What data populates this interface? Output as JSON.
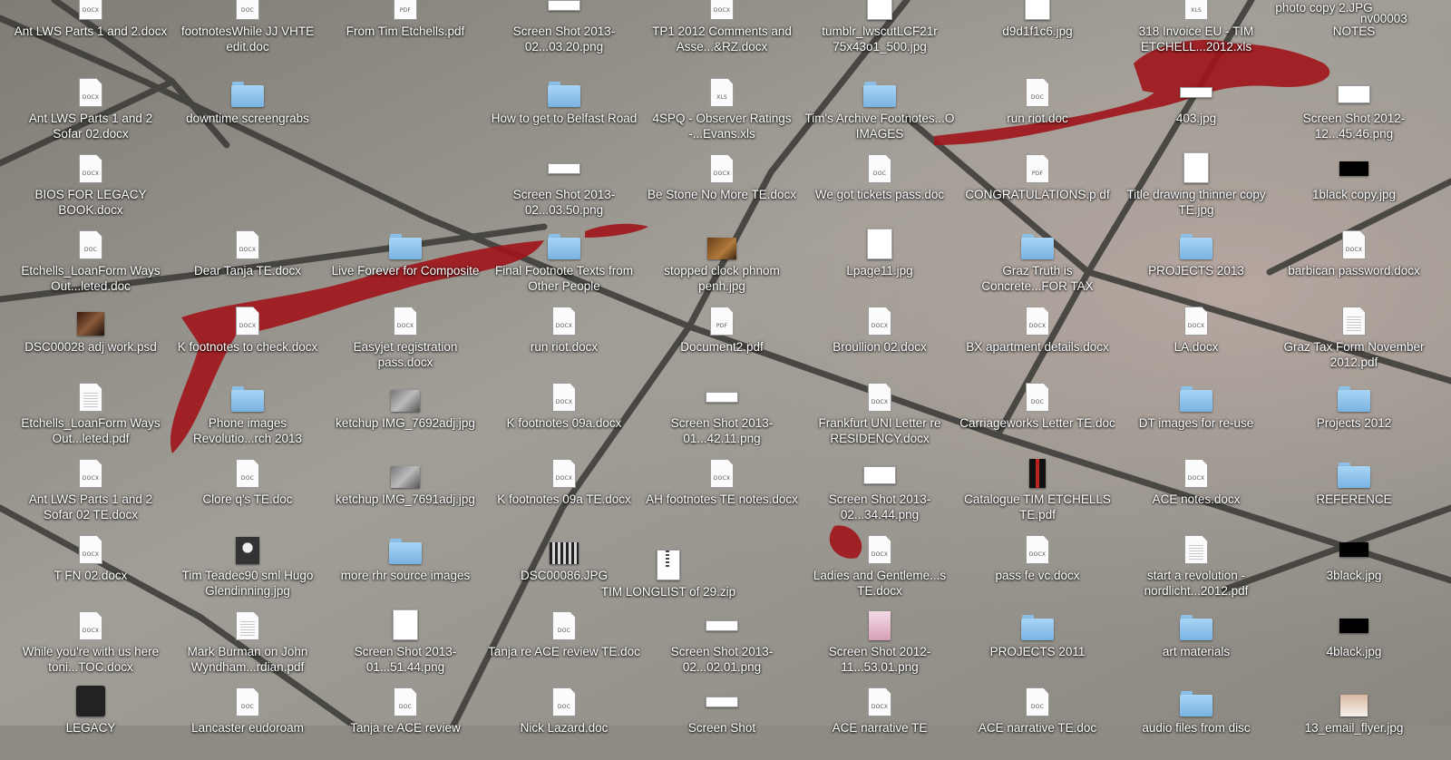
{
  "desktop": {
    "wallpaper": "street paving stones with red ketchup splatter",
    "icons": [
      [
        {
          "label": "Ant LWS Parts 1 and 2.docx",
          "icon": "doc-icon",
          "tag": "DOCX"
        },
        {
          "label": "Ant LWS Parts 1 and 2 Sofar 02.docx",
          "icon": "doc-icon",
          "tag": "DOCX"
        },
        {
          "label": "BIOS FOR LEGACY BOOK.docx",
          "icon": "doc-icon",
          "tag": "DOCX"
        },
        {
          "label": "Etchells_LoanForm Ways Out...leted.doc",
          "icon": "doc-icon",
          "tag": "DOC"
        },
        {
          "label": "DSC00028 adj work.psd",
          "icon": "image-thumb-icon",
          "thumb": "photo"
        },
        {
          "label": "Etchells_LoanForm Ways Out...leted.pdf",
          "icon": "doc-icon",
          "tag": "",
          "lines": true
        },
        {
          "label": "Ant LWS Parts 1 and 2 Sofar 02 TE.docx",
          "icon": "doc-icon",
          "tag": "DOCX"
        },
        {
          "label": "T FN 02.docx",
          "icon": "doc-icon",
          "tag": "DOCX"
        },
        {
          "label": "While you're with us here toni...TOC.docx",
          "icon": "doc-icon",
          "tag": "DOCX"
        },
        {
          "label": "LEGACY",
          "icon": "image-thumb-icon",
          "thumb": "legacy"
        }
      ],
      [
        {
          "label": "footnotesWhile JJ VHTE edit.doc",
          "icon": "doc-icon",
          "tag": "DOC"
        },
        {
          "label": "downtime screengrabs",
          "icon": "folder-icon"
        },
        {
          "label": "",
          "icon": "none"
        },
        {
          "label": "Dear Tanja TE.docx",
          "icon": "doc-icon",
          "tag": "DOCX"
        },
        {
          "label": "K footnotes to check.docx",
          "icon": "doc-icon",
          "tag": "DOCX"
        },
        {
          "label": "Phone images Revolutio...rch 2013",
          "icon": "folder-icon"
        },
        {
          "label": "Clore q's TE.doc",
          "icon": "doc-icon",
          "tag": "DOC"
        },
        {
          "label": "Tim Teadec90 sml Hugo Glendinning.jpg",
          "icon": "image-thumb-icon",
          "thumb": "face"
        },
        {
          "label": "Mark Burman on John Wyndham...rdian.pdf",
          "icon": "doc-icon",
          "tag": "",
          "lines": true
        },
        {
          "label": "Lancaster eudoroam",
          "icon": "doc-icon",
          "tag": "DOC"
        }
      ],
      [
        {
          "label": "From Tim Etchells.pdf",
          "icon": "doc-icon",
          "tag": "PDF"
        },
        {
          "label": "",
          "icon": "none"
        },
        {
          "label": "",
          "icon": "none"
        },
        {
          "label": "Live Forever for Composite",
          "icon": "folder-icon"
        },
        {
          "label": "Easyjet registration pass.docx",
          "icon": "doc-icon",
          "tag": "DOCX"
        },
        {
          "label": "ketchup IMG_7692adj.jpg",
          "icon": "image-thumb-icon",
          "thumb": "grey"
        },
        {
          "label": "ketchup IMG_7691adj.jpg",
          "icon": "image-thumb-icon",
          "thumb": "grey"
        },
        {
          "label": "more rhr source images",
          "icon": "folder-icon"
        },
        {
          "label": "Screen Shot 2013-01...51.44.png",
          "icon": "image-thumb-icon",
          "thumb": "white"
        },
        {
          "label": "Tanja re ACE review",
          "icon": "doc-icon",
          "tag": "DOC"
        }
      ],
      [
        {
          "label": "Screen Shot 2013-02...03.20.png",
          "icon": "screenshot-icon"
        },
        {
          "label": "How to get to Belfast Road",
          "icon": "folder-icon"
        },
        {
          "label": "Screen Shot 2013-02...03.50.png",
          "icon": "screenshot-icon"
        },
        {
          "label": "Final Footnote Texts from Other People",
          "icon": "folder-icon"
        },
        {
          "label": "run riot.docx",
          "icon": "doc-icon",
          "tag": "DOCX"
        },
        {
          "label": "K footnotes 09a.docx",
          "icon": "doc-icon",
          "tag": "DOCX"
        },
        {
          "label": "K footnotes 09a TE.docx",
          "icon": "doc-icon",
          "tag": "DOCX"
        },
        {
          "label": "DSC00086.JPG",
          "icon": "image-thumb-icon",
          "thumb": "film"
        },
        {
          "label": "Tanja re ACE review TE.doc",
          "icon": "doc-icon",
          "tag": "DOC"
        },
        {
          "label": "Nick Lazard.doc",
          "icon": "doc-icon",
          "tag": "DOC"
        }
      ],
      [
        {
          "label": "TP1 2012 Comments and Asse...&RZ.docx",
          "icon": "doc-icon",
          "tag": "DOCX"
        },
        {
          "label": "4SPQ - Observer Ratings -...Evans.xls",
          "icon": "doc-icon",
          "tag": "XLS"
        },
        {
          "label": "Be Stone No More TE.docx",
          "icon": "doc-icon",
          "tag": "DOCX"
        },
        {
          "label": "stopped clock phnom penh.jpg",
          "icon": "image-thumb-icon",
          "thumb": "brown"
        },
        {
          "label": "Document2.pdf",
          "icon": "doc-icon",
          "tag": "PDF"
        },
        {
          "label": "Screen Shot 2013-01...42.11.png",
          "icon": "screenshot-icon"
        },
        {
          "label": "AH footnotes TE notes.docx",
          "icon": "doc-icon",
          "tag": "DOCX"
        },
        {
          "label": "",
          "icon": "none"
        },
        {
          "label": "Screen Shot 2013-02...02.01.png",
          "icon": "screenshot-icon"
        },
        {
          "label": "Screen Shot",
          "icon": "screenshot-icon"
        }
      ],
      [
        {
          "label": "tumblr_lwscutLCF21r 75x43o1_500.jpg",
          "icon": "image-thumb-icon",
          "thumb": "white"
        },
        {
          "label": "Tim's Archive Footnotes...O IMAGES",
          "icon": "folder-icon"
        },
        {
          "label": "We got tickets pass.doc",
          "icon": "doc-icon",
          "tag": "DOC"
        },
        {
          "label": "Lpage11.jpg",
          "icon": "image-thumb-icon",
          "thumb": "white"
        },
        {
          "label": "Broullion 02.docx",
          "icon": "doc-icon",
          "tag": "DOCX"
        },
        {
          "label": "Frankfurt UNI Letter re RESIDENCY.docx",
          "icon": "doc-icon",
          "tag": "DOCX"
        },
        {
          "label": "Screen Shot 2013-02...34.44.png",
          "icon": "screenshot-tall-icon"
        },
        {
          "label": "Ladies and Gentleme...s TE.docx",
          "icon": "doc-icon",
          "tag": "DOCX"
        },
        {
          "label": "Screen Shot 2012-11...53.01.png",
          "icon": "image-thumb-icon",
          "thumb": "pink"
        },
        {
          "label": "ACE narrative TE",
          "icon": "doc-icon",
          "tag": "DOCX"
        }
      ],
      [
        {
          "label": "d9d1f1c6.jpg",
          "icon": "image-thumb-icon",
          "thumb": "white"
        },
        {
          "label": "run riot.doc",
          "icon": "doc-icon",
          "tag": "DOC"
        },
        {
          "label": "CONGRATULATIONS.p df",
          "icon": "doc-icon",
          "tag": "PDF"
        },
        {
          "label": "Graz Truth is Concrete...FOR TAX",
          "icon": "folder-icon"
        },
        {
          "label": "BX apartment details.docx",
          "icon": "doc-icon",
          "tag": "DOCX"
        },
        {
          "label": "Carriageworks Letter TE.doc",
          "icon": "doc-icon",
          "tag": "DOC"
        },
        {
          "label": "Catalogue TIM ETCHELLS TE.pdf",
          "icon": "image-thumb-icon",
          "thumb": "catalog"
        },
        {
          "label": "pass fe vc.docx",
          "icon": "doc-icon",
          "tag": "DOCX"
        },
        {
          "label": "PROJECTS 2011",
          "icon": "folder-icon"
        },
        {
          "label": "ACE narrative TE.doc",
          "icon": "doc-icon",
          "tag": "DOC"
        }
      ],
      [
        {
          "label": "318 Invoice EU - TIM ETCHELL...2012.xls",
          "icon": "doc-icon",
          "tag": "XLS"
        },
        {
          "label": "403.jpg",
          "icon": "screenshot-icon"
        },
        {
          "label": "Title drawing thinner copy TE.jpg",
          "icon": "image-thumb-icon",
          "thumb": "white"
        },
        {
          "label": "PROJECTS 2013",
          "icon": "folder-icon"
        },
        {
          "label": "LA.docx",
          "icon": "doc-icon",
          "tag": "DOCX"
        },
        {
          "label": "DT images for re-use",
          "icon": "folder-icon"
        },
        {
          "label": "ACE notes.docx",
          "icon": "doc-icon",
          "tag": "DOCX"
        },
        {
          "label": "start a revolution - nordlicht...2012.pdf",
          "icon": "doc-icon",
          "tag": "",
          "lines": true
        },
        {
          "label": "art materials",
          "icon": "folder-icon"
        },
        {
          "label": "audio files from disc",
          "icon": "folder-icon"
        }
      ],
      [
        {
          "label": "NOTES",
          "icon": "none"
        },
        {
          "label": "Screen Shot 2012-12...45.46.png",
          "icon": "screenshot-tall-icon"
        },
        {
          "label": "1black copy.jpg",
          "icon": "image-thumb-icon",
          "thumb": "black"
        },
        {
          "label": "barbican password.docx",
          "icon": "doc-icon",
          "tag": "DOCX"
        },
        {
          "label": "Graz Tax Form November 2012.pdf",
          "icon": "doc-icon",
          "tag": "",
          "lines": true
        },
        {
          "label": "Projects 2012",
          "icon": "folder-icon"
        },
        {
          "label": "REFERENCE",
          "icon": "folder-icon"
        },
        {
          "label": "3black.jpg",
          "icon": "image-thumb-icon",
          "thumb": "black"
        },
        {
          "label": "4black.jpg",
          "icon": "image-thumb-icon",
          "thumb": "black"
        },
        {
          "label": "13_email_flyer.jpg",
          "icon": "image-thumb-icon",
          "thumb": "flyer"
        }
      ]
    ],
    "extras": {
      "zip_label": "TIM LONGLIST of 29.zip",
      "photo_copy_label": "photo copy 2.JPG",
      "partial_label": "nv00003"
    }
  }
}
